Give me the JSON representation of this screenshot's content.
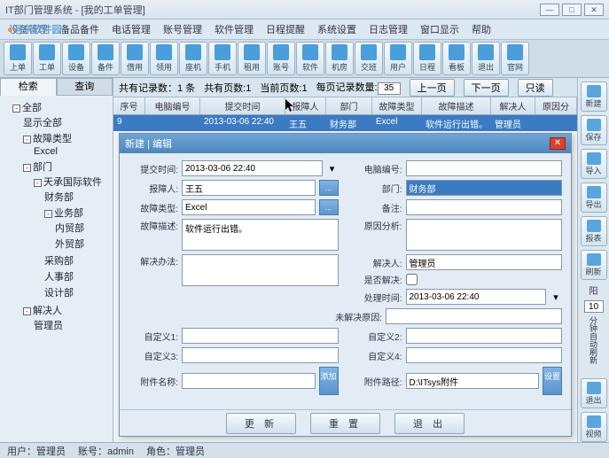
{
  "watermark": "河东软件园",
  "title": "IT部门管理系统 - [我的工单管理]",
  "menu": [
    "设备管理",
    "备品备件",
    "电话管理",
    "账号管理",
    "软件管理",
    "日程提醒",
    "系统设置",
    "日志管理",
    "窗口显示",
    "帮助"
  ],
  "toolbar": [
    {
      "lbl": "上单"
    },
    {
      "lbl": "工单"
    },
    {
      "lbl": "设备"
    },
    {
      "lbl": "备件"
    },
    {
      "lbl": "借用"
    },
    {
      "lbl": "领用"
    },
    {
      "lbl": "座机"
    },
    {
      "lbl": "手机"
    },
    {
      "lbl": "租用"
    },
    {
      "lbl": "账号"
    },
    {
      "lbl": "软件"
    },
    {
      "lbl": "机房"
    },
    {
      "lbl": "交班"
    },
    {
      "lbl": "用户"
    },
    {
      "lbl": "日程"
    },
    {
      "lbl": "看板"
    },
    {
      "lbl": "退出"
    },
    {
      "lbl": "官网"
    }
  ],
  "lefttabs": {
    "t1": "检索",
    "t2": "查询"
  },
  "tree": {
    "root": "全部",
    "showall": "显示全部",
    "faulttype": "故障类型",
    "excel": "Excel",
    "dept": "部门",
    "tj": "天承国际软件",
    "fin": "财务部",
    "biz": "业务部",
    "intrade": "内贸部",
    "extrade": "外贸部",
    "purchase": "采购部",
    "hr": "人事部",
    "design": "设计部",
    "solver": "解决人",
    "admin": "管理员"
  },
  "pager": {
    "total_lbl": "共有记录数：",
    "total": "1 条",
    "pages_lbl": "共有页数:",
    "pages": "1",
    "cur_lbl": "当前页数:",
    "cur": "1",
    "perpage_lbl": "每页记录数量:",
    "perpage": "35",
    "prev": "上一页",
    "next": "下一页",
    "readonly": "只读"
  },
  "grid": {
    "h": [
      "序号",
      "电脑编号",
      "提交时间",
      "报障人",
      "部门",
      "故障类型",
      "故障描述",
      "解决人",
      "原因分析"
    ],
    "row": {
      "seq": "9",
      "time": "2013-03-06 22:40",
      "person": "王五",
      "dept": "财务部",
      "type": "Excel",
      "desc": "软件运行出错。",
      "solver": "管理员"
    }
  },
  "right": [
    {
      "lbl": "新建"
    },
    {
      "lbl": "保存"
    },
    {
      "lbl": "导入"
    },
    {
      "lbl": "导出"
    },
    {
      "lbl": "报表"
    },
    {
      "lbl": "刷新"
    }
  ],
  "right_extra": {
    "yang": "阳",
    "num": "10",
    "auto": "分钟自动刷新"
  },
  "right_bottom": [
    {
      "lbl": "退出"
    },
    {
      "lbl": "视频"
    }
  ],
  "dialog": {
    "title": "新建 | 编辑",
    "labels": {
      "submit_time": "提交时间:",
      "pc_no": "电脑编号:",
      "reporter": "报障人:",
      "dept": "部门:",
      "fault_type": "故障类型:",
      "remark": "备注:",
      "fault_desc": "故障描述:",
      "cause": "原因分析:",
      "solution": "解决办法:",
      "solver": "解决人:",
      "solved": "是否解决:",
      "handle_time": "处理时间:",
      "unsolved_reason": "未解决原因:",
      "c1": "自定义1:",
      "c2": "自定义2:",
      "c3": "自定义3:",
      "c4": "自定义4:",
      "att_name": "附件名称:",
      "att_path": "附件路径:"
    },
    "values": {
      "submit_time": "2013-03-06 22:40",
      "reporter": "王五",
      "dept": "财务部",
      "fault_type": "Excel",
      "fault_desc": "软件运行出错。",
      "solver": "管理员",
      "handle_time": "2013-03-06 22:40",
      "att_path": "D:\\ITsys附件"
    },
    "btns": {
      "dots": "...",
      "add": "添加",
      "set": "设置",
      "update": "更 新",
      "reset": "重 置",
      "exit": "退 出"
    }
  },
  "status": {
    "user_lbl": "用户：",
    "user": "管理员",
    "acct_lbl": "账号：",
    "acct": "admin",
    "role_lbl": "角色：",
    "role": "管理员"
  }
}
